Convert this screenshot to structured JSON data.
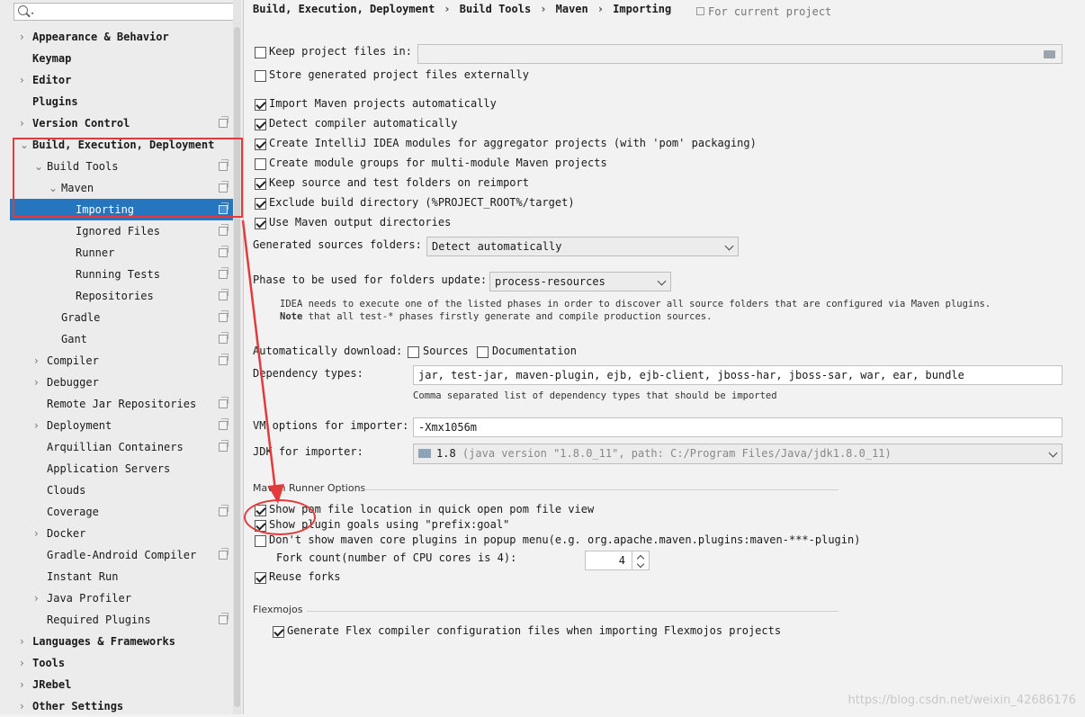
{
  "search": {
    "placeholder": ""
  },
  "sidebar": {
    "items": [
      {
        "label": "Appearance & Behavior"
      },
      {
        "label": "Keymap"
      },
      {
        "label": "Editor"
      },
      {
        "label": "Plugins"
      },
      {
        "label": "Version Control"
      },
      {
        "label": "Build, Execution, Deployment"
      },
      {
        "label": "Build Tools"
      },
      {
        "label": "Maven"
      },
      {
        "label": "Importing"
      },
      {
        "label": "Ignored Files"
      },
      {
        "label": "Runner"
      },
      {
        "label": "Running Tests"
      },
      {
        "label": "Repositories"
      },
      {
        "label": "Gradle"
      },
      {
        "label": "Gant"
      },
      {
        "label": "Compiler"
      },
      {
        "label": "Debugger"
      },
      {
        "label": "Remote Jar Repositories"
      },
      {
        "label": "Deployment"
      },
      {
        "label": "Arquillian Containers"
      },
      {
        "label": "Application Servers"
      },
      {
        "label": "Clouds"
      },
      {
        "label": "Coverage"
      },
      {
        "label": "Docker"
      },
      {
        "label": "Gradle-Android Compiler"
      },
      {
        "label": "Instant Run"
      },
      {
        "label": "Java Profiler"
      },
      {
        "label": "Required Plugins"
      },
      {
        "label": "Languages & Frameworks"
      },
      {
        "label": "Tools"
      },
      {
        "label": "JRebel"
      },
      {
        "label": "Other Settings"
      }
    ]
  },
  "breadcrumb": {
    "parts": [
      "Build, Execution, Deployment",
      "Build Tools",
      "Maven",
      "Importing"
    ],
    "separator": "›",
    "scope": "For current project"
  },
  "options": {
    "keep_project_files": {
      "label": "Keep project files in:",
      "checked": false
    },
    "store_generated": {
      "label": "Store generated project files externally",
      "checked": false
    },
    "import_auto": {
      "label": "Import Maven projects automatically",
      "checked": true
    },
    "detect_compiler": {
      "label": "Detect compiler automatically",
      "checked": true
    },
    "create_modules": {
      "label": "Create IntelliJ IDEA modules for aggregator projects (with 'pom' packaging)",
      "checked": true
    },
    "create_groups": {
      "label": "Create module groups for multi-module Maven projects",
      "checked": false
    },
    "keep_source": {
      "label": "Keep source and test folders on reimport",
      "checked": true
    },
    "exclude_build": {
      "label": "Exclude build directory (%PROJECT_ROOT%/target)",
      "checked": true
    },
    "use_output": {
      "label": "Use Maven output directories",
      "checked": true
    }
  },
  "generated_sources": {
    "label": "Generated sources folders:",
    "value": "Detect automatically"
  },
  "phase": {
    "label": "Phase to be used for folders update:",
    "value": "process-resources",
    "hint1": "IDEA needs to execute one of the listed phases in order to discover all source folders that are configured via Maven plugins.",
    "hint2_bold": "Note",
    "hint2": " that all test-* phases firstly generate and compile production sources."
  },
  "auto_download": {
    "label": "Automatically download:",
    "sources": "Sources",
    "documentation": "Documentation"
  },
  "dependency_types": {
    "label": "Dependency types:",
    "value": "jar, test-jar, maven-plugin, ejb, ejb-client, jboss-har, jboss-sar, war, ear, bundle",
    "hint": "Comma separated list of dependency types that should be imported"
  },
  "vm_options": {
    "label": "VM options for importer:",
    "value": "-Xmx1056m"
  },
  "jdk": {
    "label": "JDK for importer:",
    "version": "1.8",
    "detail": "(java version \"1.8.0_11\", path: C:/Program Files/Java/jdk1.8.0_11)"
  },
  "runner_options": {
    "title": "Maven Runner Options",
    "show_pom": {
      "label": "Show pom file location in quick open pom file view",
      "checked": true
    },
    "show_goals": {
      "label": "Show plugin goals using \"prefix:goal\"",
      "checked": true
    },
    "dont_show_core": {
      "label": "Don't show maven core plugins in popup menu(e.g. org.apache.maven.plugins:maven-***-plugin)",
      "checked": false
    },
    "fork_count": {
      "label": "Fork count(number of CPU cores is 4):",
      "value": "4"
    },
    "reuse_forks": {
      "label": "Reuse forks",
      "checked": true
    }
  },
  "flexmojos": {
    "title": "Flexmojos",
    "generate": {
      "label": "Generate Flex compiler configuration files when importing Flexmojos projects",
      "checked": true
    }
  },
  "watermark": "https://blog.csdn.net/weixin_42686176",
  "colors": {
    "selection": "#2675bf",
    "annotation": "#e33b3b"
  }
}
